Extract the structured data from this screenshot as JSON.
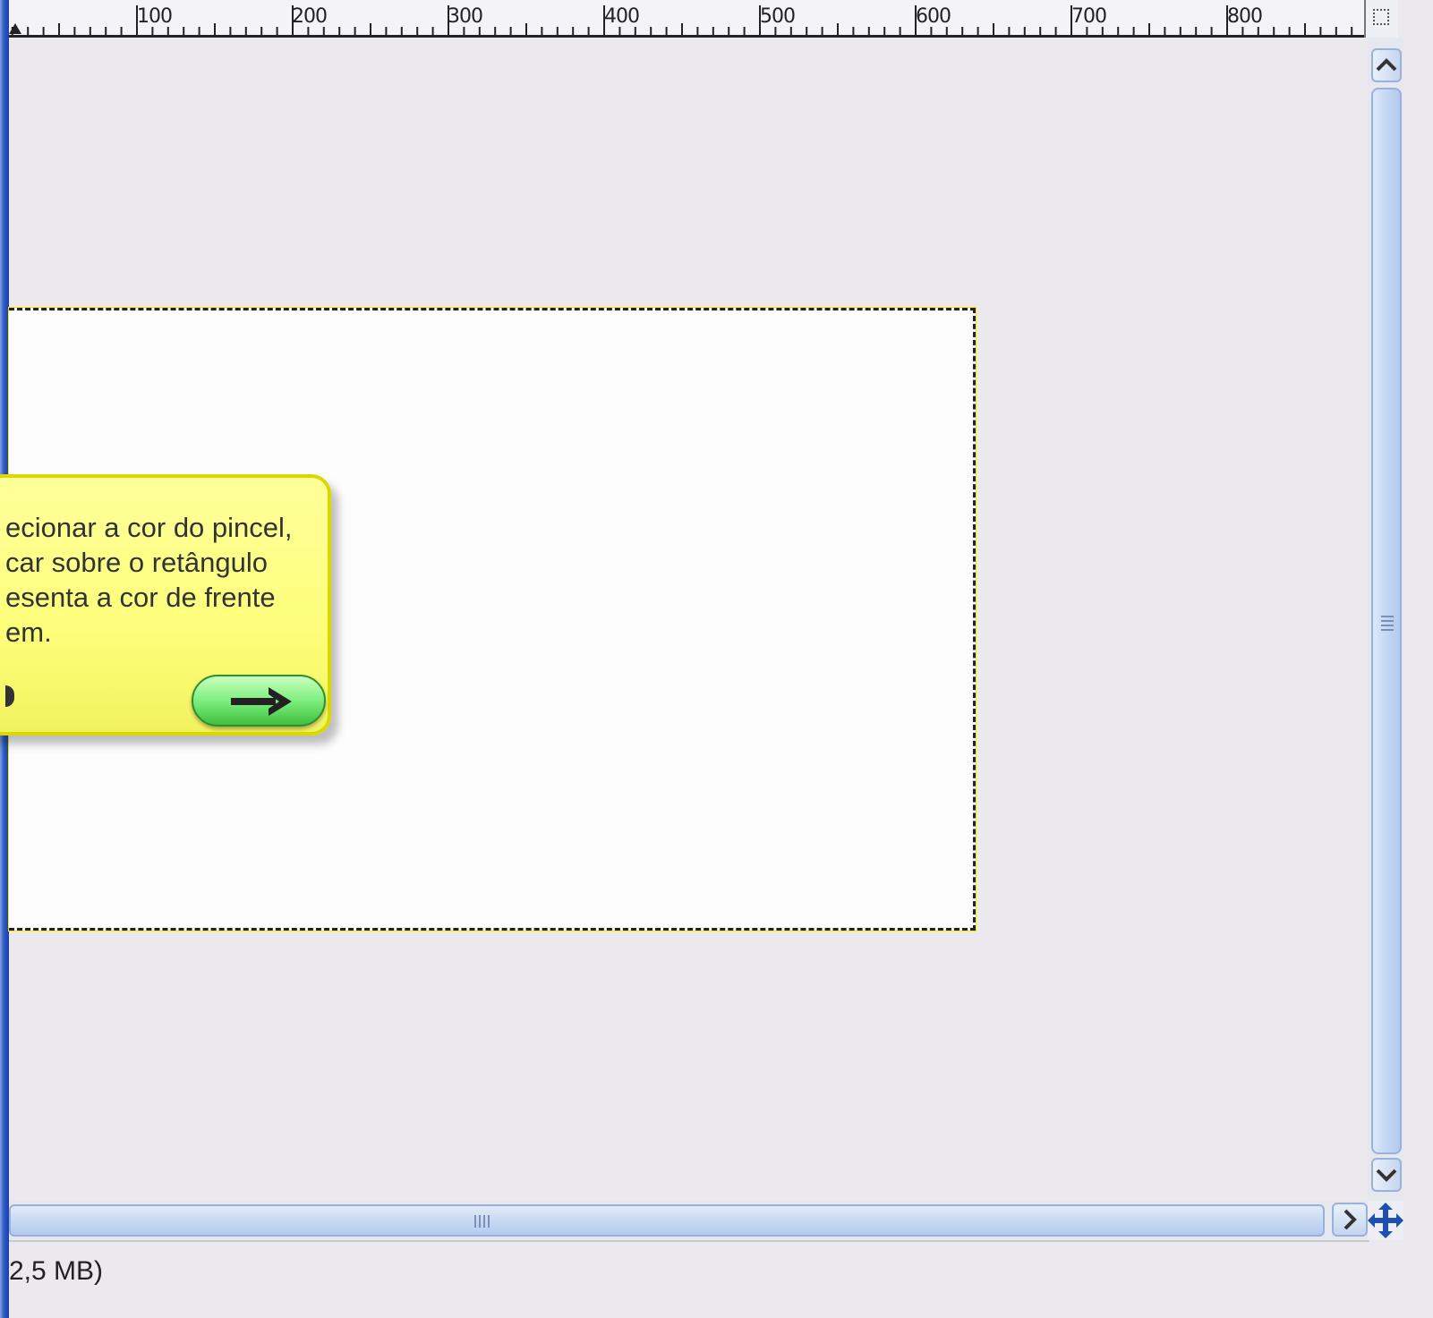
{
  "ruler": {
    "labels": [
      "100",
      "200",
      "300",
      "400",
      "500",
      "600",
      "700",
      "800"
    ]
  },
  "tooltip": {
    "lines": [
      "ecionar a cor do pincel,",
      "car sobre o retângulo",
      "esenta a cor de frente",
      "em."
    ],
    "next_button_icon": "arrow-right-icon"
  },
  "statusbar": {
    "text": "2,5 MB)"
  },
  "icons": {
    "scroll_up": "chevron-up-icon",
    "scroll_down": "chevron-down-icon",
    "scroll_right": "chevron-right-icon",
    "navigate": "navigate-move-icon",
    "zoom": "zoom-selection-icon"
  },
  "colors": {
    "tooltip_bg": "#ffff88",
    "next_button": "#7eef7e",
    "selection_marquee": "#ffe600"
  }
}
